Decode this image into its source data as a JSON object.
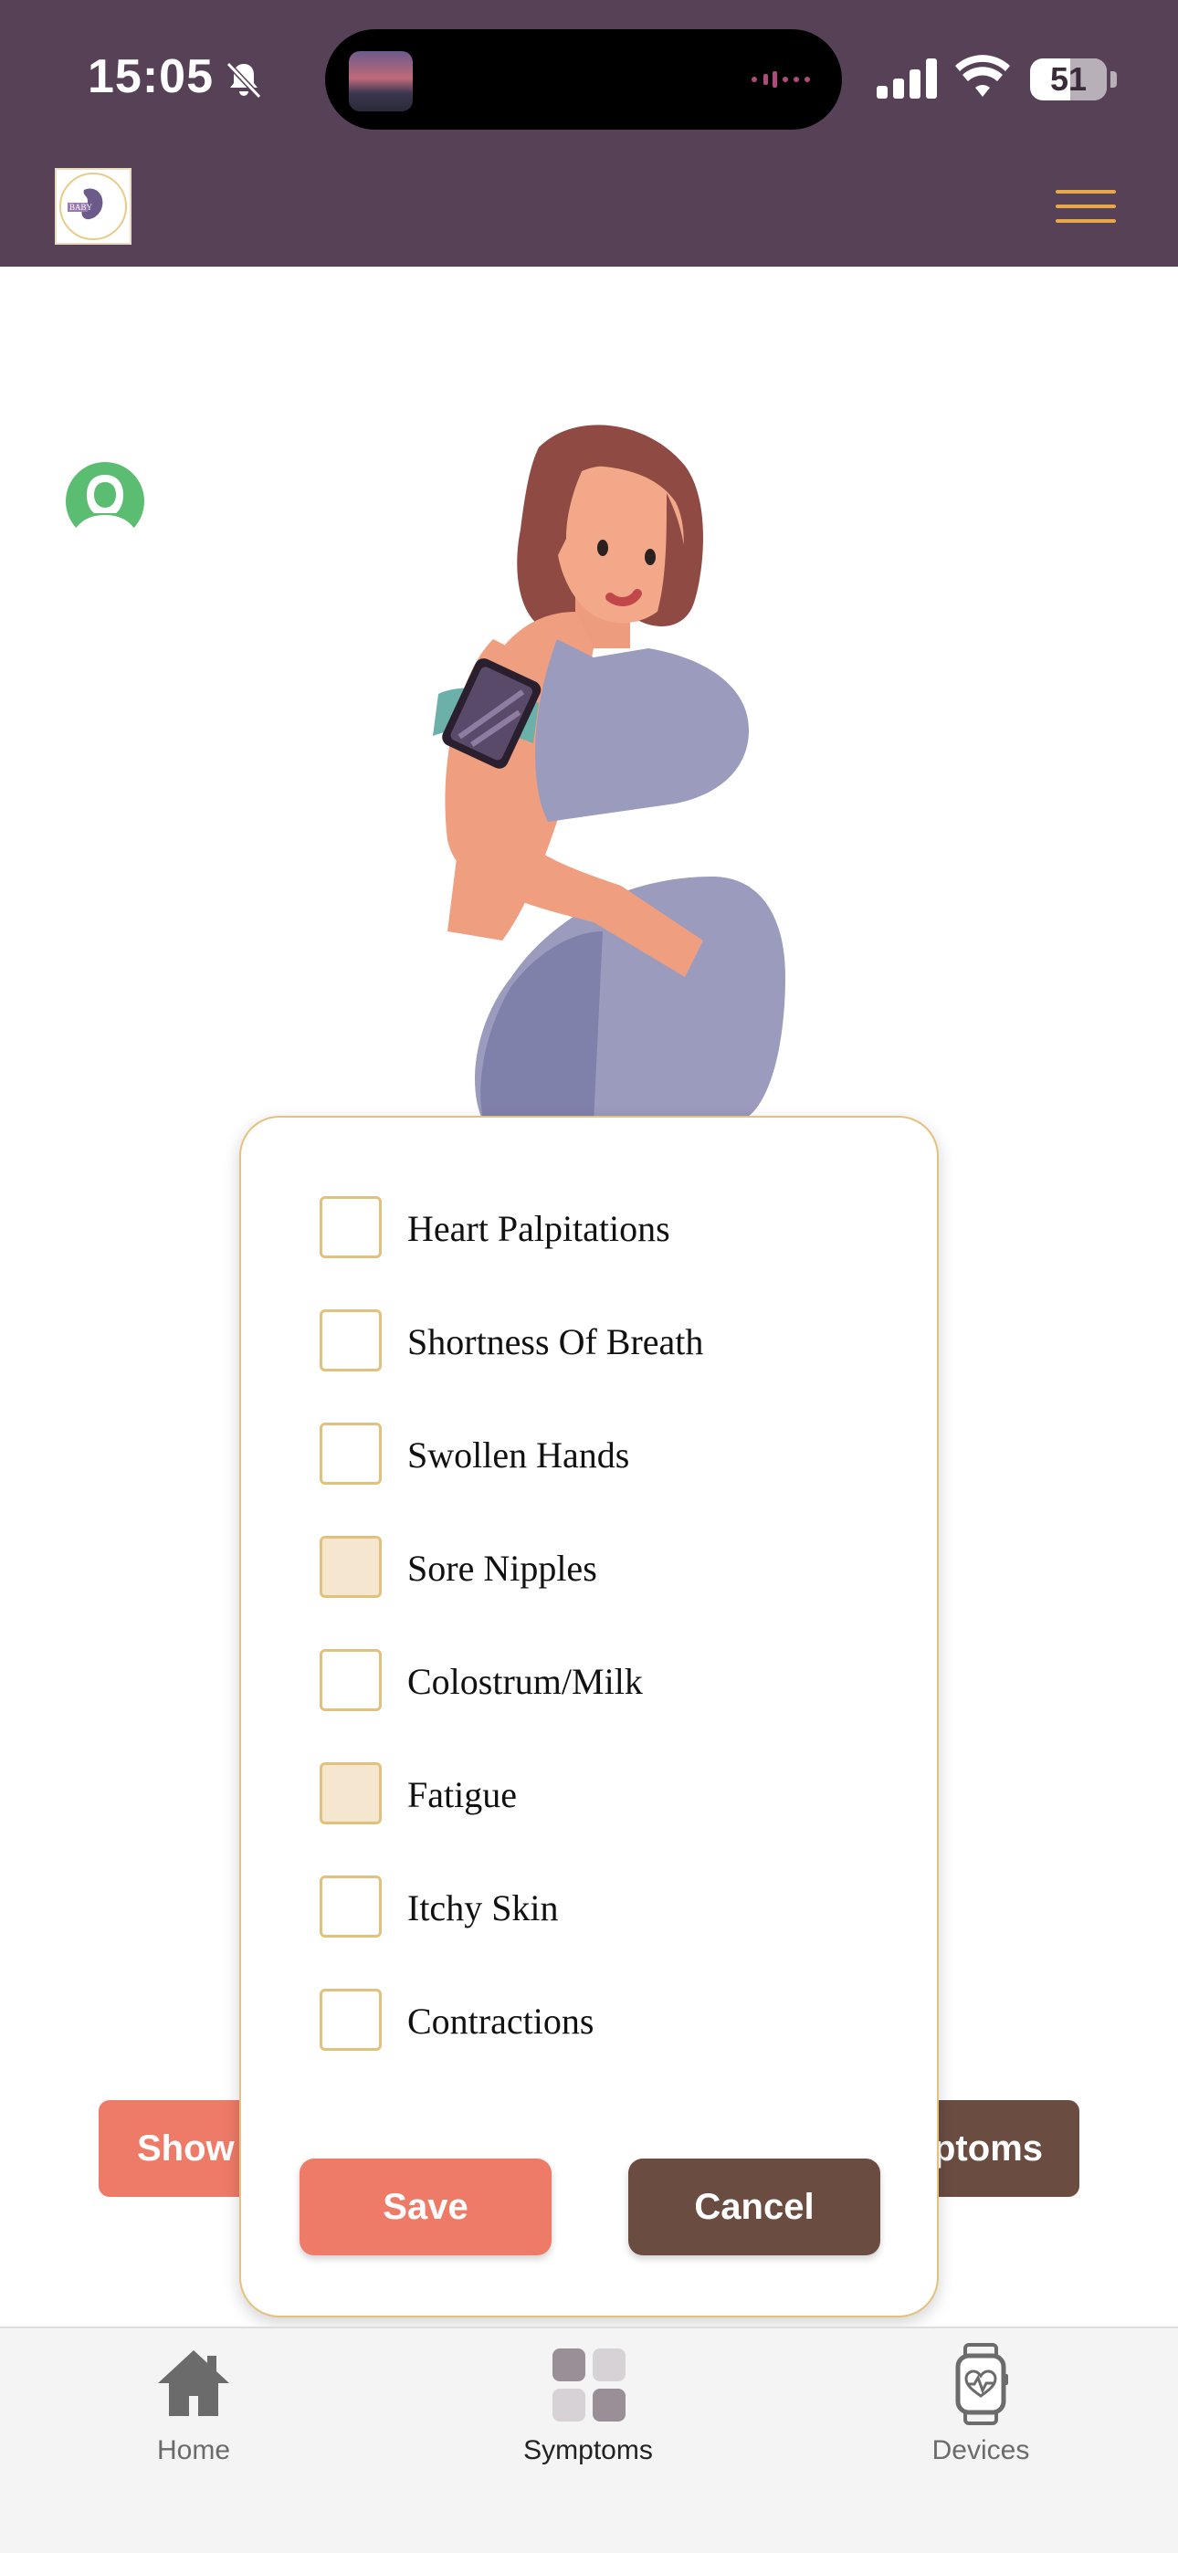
{
  "status": {
    "time": "15:05",
    "battery": "51"
  },
  "header": {
    "logo_icon": "brand-logo",
    "menu_icon": "hamburger-menu-icon"
  },
  "colors": {
    "header_bg": "#574157",
    "accent_gold": "#e6a84c",
    "save": "#ee7b67",
    "cancel": "#6b4c41"
  },
  "background_buttons": {
    "left": "Show",
    "right": "ptoms"
  },
  "symptoms": [
    {
      "label": "Heart Palpitations",
      "checked": false
    },
    {
      "label": "Shortness Of Breath",
      "checked": false
    },
    {
      "label": "Swollen Hands",
      "checked": false
    },
    {
      "label": "Sore Nipples",
      "checked": true
    },
    {
      "label": "Colostrum/Milk",
      "checked": false
    },
    {
      "label": "Fatigue",
      "checked": true
    },
    {
      "label": "Itchy Skin",
      "checked": false
    },
    {
      "label": "Contractions",
      "checked": false
    }
  ],
  "modal": {
    "save_label": "Save",
    "cancel_label": "Cancel"
  },
  "tabs": [
    {
      "label": "Home",
      "icon": "home-icon",
      "active": false
    },
    {
      "label": "Symptoms",
      "icon": "grid-icon",
      "active": true
    },
    {
      "label": "Devices",
      "icon": "smartwatch-icon",
      "active": false
    }
  ]
}
